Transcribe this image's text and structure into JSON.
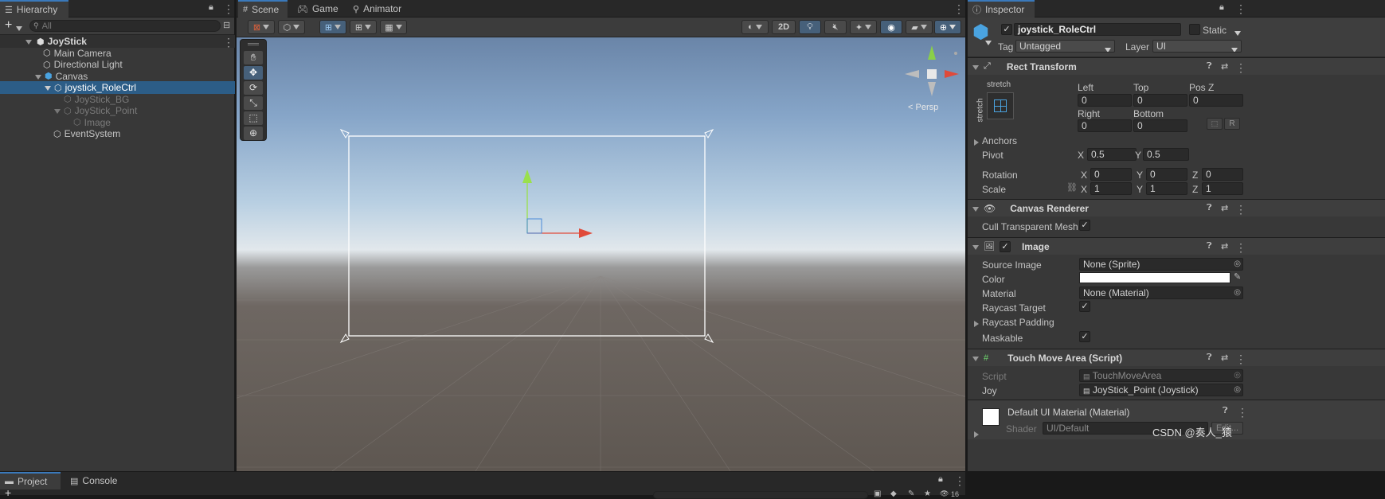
{
  "hierarchy": {
    "tab_label": "Hierarchy",
    "add_label": "+",
    "search_placeholder": "All",
    "items": [
      {
        "label": "JoyStick"
      },
      {
        "label": "Main Camera"
      },
      {
        "label": "Directional Light"
      },
      {
        "label": "Canvas"
      },
      {
        "label": "joystick_RoleCtrl"
      },
      {
        "label": "JoyStick_BG"
      },
      {
        "label": "JoyStick_Point"
      },
      {
        "label": "Image"
      },
      {
        "label": "EventSystem"
      }
    ]
  },
  "scene": {
    "tabs": [
      {
        "label": "Scene"
      },
      {
        "label": "Game"
      },
      {
        "label": "Animator"
      }
    ],
    "toolbar": {
      "mode_2d": "2D"
    },
    "gizmo": {
      "projection": "Persp"
    }
  },
  "inspector": {
    "tab_label": "Inspector",
    "object_name": "joystick_RoleCtrl",
    "static_label": "Static",
    "tag_label": "Tag",
    "tag_value": "Untagged",
    "layer_label": "Layer",
    "layer_value": "UI",
    "rect_transform": {
      "title": "Rect Transform",
      "anchor_h": "stretch",
      "anchor_v": "stretch",
      "left_label": "Left",
      "left": "0",
      "top_label": "Top",
      "top": "0",
      "posz_label": "Pos Z",
      "posz": "0",
      "right_label": "Right",
      "right": "0",
      "bottom_label": "Bottom",
      "bottom": "0",
      "r_button": "R",
      "anchors_label": "Anchors",
      "pivot_label": "Pivot",
      "pivot_x": "0.5",
      "pivot_y": "0.5",
      "rotation_label": "Rotation",
      "rot_x": "0",
      "rot_y": "0",
      "rot_z": "0",
      "scale_label": "Scale",
      "scale_x": "1",
      "scale_y": "1",
      "scale_z": "1",
      "x": "X",
      "y": "Y",
      "z": "Z"
    },
    "canvas_renderer": {
      "title": "Canvas Renderer",
      "cull_label": "Cull Transparent Mesh"
    },
    "image": {
      "title": "Image",
      "source_label": "Source Image",
      "source_value": "None (Sprite)",
      "color_label": "Color",
      "color_value": "#ffffff",
      "material_label": "Material",
      "material_value": "None (Material)",
      "raycast_target_label": "Raycast Target",
      "raycast_padding_label": "Raycast Padding",
      "maskable_label": "Maskable"
    },
    "touch_move": {
      "title": "Touch Move Area (Script)",
      "script_label": "Script",
      "script_value": "TouchMoveArea",
      "joy_label": "Joy",
      "joy_value": "JoyStick_Point (Joystick)"
    },
    "material": {
      "title": "Default UI Material (Material)",
      "shader_label": "Shader",
      "shader_value": "UI/Default",
      "edit_label": "Edit..."
    }
  },
  "bottom": {
    "tabs": [
      {
        "label": "Project"
      },
      {
        "label": "Console"
      }
    ],
    "count": "16"
  },
  "watermark": "CSDN @奏人_猿",
  "colors": {
    "accent": "#3a79bb",
    "selection": "#2c5d87",
    "panel": "#383838"
  }
}
